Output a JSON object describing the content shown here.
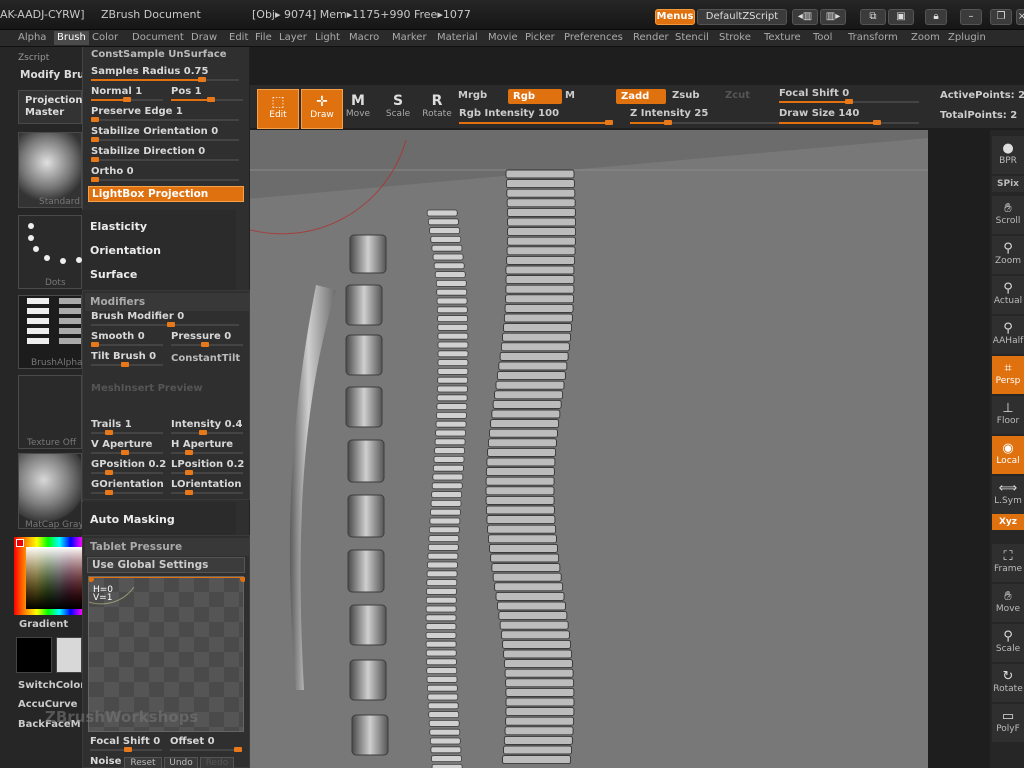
{
  "titlebar": {
    "project_id": "AK-AADJ-CYRW]",
    "doc_title": "ZBrush Document",
    "obj_info": "[Obj▸ 9074] Mem▸1175+990  Free▸1077",
    "menus_btn": "Menus",
    "script_btn": "DefaultZScript"
  },
  "menubar": [
    "Alpha",
    "Brush",
    "Color",
    "Document",
    "Draw",
    "Edit",
    "File",
    "Layer",
    "Light",
    "Macro",
    "Marker",
    "Material",
    "Movie",
    "Picker",
    "Preferences",
    "Render",
    "Stencil",
    "Stroke",
    "Texture",
    "Tool",
    "Transform",
    "Zoom",
    "Zplugin"
  ],
  "left": {
    "zscript": "Zscript",
    "modify": "Modify Bru",
    "projection_master": "Projection Master",
    "standard": "Standard",
    "dots": "Dots",
    "brushalpha": "BrushAlpha",
    "texture": "Texture Off",
    "matcap": "MatCap Gray",
    "gradient": "Gradient",
    "switchcolor": "SwitchColor",
    "accucurve": "AccuCurve",
    "backface": "BackFaceM"
  },
  "flyout": {
    "cut_top": "ConstSample  UnSurface",
    "samples_radius": "Samples Radius",
    "samples_radius_val": "0.75",
    "normal": "Normal 1",
    "pos": "Pos 1",
    "preserve_edge": "Preserve Edge 1",
    "stabilize_orientation": "Stabilize Orientation 0",
    "stabilize_direction": "Stabilize Direction 0",
    "ortho": "Ortho 0",
    "lightbox_projection": "LightBox Projection",
    "elasticity": "Elasticity",
    "orientation": "Orientation",
    "surface": "Surface",
    "modifiers": "Modifiers",
    "brush_modifier": "Brush Modifier 0",
    "smooth": "Smooth 0",
    "pressure": "Pressure 0",
    "tilt_brush": "Tilt Brush 0",
    "constant_tilt": "ConstantTilt",
    "mesh_insert_preview": "MeshInsert Preview",
    "trails": "Trails 1",
    "intensity": "Intensity 0.4",
    "v_aperture": "V Aperture",
    "h_aperture": "H Aperture",
    "gposition": "GPosition 0.2",
    "lposition": "LPosition 0.2",
    "gorientation": "GOrientation",
    "lorientation": "LOrientation",
    "auto_masking": "Auto Masking",
    "tablet_pressure": "Tablet Pressure",
    "use_global": "Use Global Settings",
    "curve_h": "H=0",
    "curve_v": "V=1",
    "watermark": "ZBrushWorkshops",
    "focal_shift": "Focal Shift",
    "focal_shift_val": "0",
    "offset": "Offset 0",
    "noise": "Noise",
    "reset": "Reset",
    "undo": "Undo",
    "redo": "Redo"
  },
  "toolbar": {
    "edit": "Edit",
    "draw": "Draw",
    "move": "Move",
    "scale": "Scale",
    "rotate": "Rotate",
    "mrgb": "Mrgb",
    "rgb": "Rgb",
    "m": "M",
    "zadd": "Zadd",
    "zsub": "Zsub",
    "zcut": "Zcut",
    "rgb_intensity": "Rgb Intensity 100",
    "z_intensity": "Z Intensity 25",
    "focal_shift": "Focal Shift 0",
    "draw_size": "Draw Size 140",
    "active_points": "ActivePoints: 2",
    "total_points": "TotalPoints: 2"
  },
  "right": [
    "BPR",
    "SPix",
    "Scroll",
    "Zoom",
    "Actual",
    "AAHalf",
    "Persp",
    "Floor",
    "Local",
    "L.Sym",
    "Xyz",
    "Frame",
    "Move",
    "Scale",
    "Rotate",
    "PolyF"
  ],
  "progress": {
    "samples_radius": 0.75,
    "normal": 0.5,
    "pos": 0.55,
    "rgb_intensity": 1.0,
    "z_intensity": 0.25,
    "focal_shift": 0.5,
    "draw_size": 0.7
  },
  "colors": {
    "accent": "#e0710f",
    "panel": "#2f2f2f",
    "viewport": "#787878"
  }
}
